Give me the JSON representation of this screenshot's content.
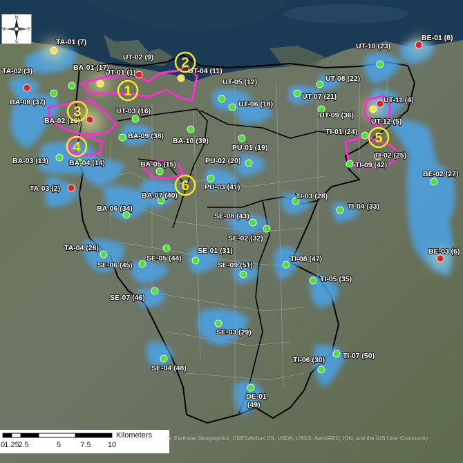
{
  "colors": {
    "green": "#4fe03a",
    "yellow": "#f4e34a",
    "red": "#e02020",
    "zone_outline": "#ff2bd6",
    "zone_label": "#ffe61a",
    "buffer": "#4aa6f0",
    "boundary": "#000000",
    "water": "#1b3a55"
  },
  "points": [
    {
      "label": "TA-01 (7)",
      "color": "yellow"
    },
    {
      "label": "UT-02 (9)",
      "color": "red"
    },
    {
      "label": "UT-01 (1)",
      "color": "yellow"
    },
    {
      "label": "UT-04 (11)",
      "color": "yellow"
    },
    {
      "label": "UT-05 (12)",
      "color": "green"
    },
    {
      "label": "UT-10 (23)",
      "color": "green"
    },
    {
      "label": "BE-01 (8)",
      "color": "red"
    },
    {
      "label": "TA-02 (3)",
      "color": "red"
    },
    {
      "label": "BA-01 (17)",
      "color": "green"
    },
    {
      "label": "BA-08 (37)",
      "color": "green"
    },
    {
      "label": "UT-08 (22)",
      "color": "green"
    },
    {
      "label": "UT-07 (21)",
      "color": "green"
    },
    {
      "label": "UT-11 (4)",
      "color": "red"
    },
    {
      "label": "UT-06 (18)",
      "color": "green"
    },
    {
      "label": "UT-03 (16)",
      "color": "green"
    },
    {
      "label": "UT-09 (36)",
      "color": "green"
    },
    {
      "label": "UT-12 (5)",
      "color": "yellow"
    },
    {
      "label": "BA-02 (10)",
      "color": "red"
    },
    {
      "label": "TI-01 (24)",
      "color": "green"
    },
    {
      "label": "BA-09 (38)",
      "color": "green"
    },
    {
      "label": "BA-10 (39)",
      "color": "green"
    },
    {
      "label": "PU-01 (19)",
      "color": "green"
    },
    {
      "label": "BA-03 (13)",
      "color": "green"
    },
    {
      "label": "BA-04 (14)",
      "color": "green"
    },
    {
      "label": "TI-02 (25)",
      "color": "green"
    },
    {
      "label": "TI-09 (42)",
      "color": "green"
    },
    {
      "label": "BA-05 (15)",
      "color": "green"
    },
    {
      "label": "PU-02 (20)",
      "color": "green"
    },
    {
      "label": "BE-02 (27)",
      "color": "green"
    },
    {
      "label": "TA-03 (2)",
      "color": "red"
    },
    {
      "label": "PU-03 (41)",
      "color": "green"
    },
    {
      "label": "BA-07 (40)",
      "color": "green"
    },
    {
      "label": "TI-03 (28)",
      "color": "green"
    },
    {
      "label": "BA-06 (34)",
      "color": "green"
    },
    {
      "label": "TI-04 (33)",
      "color": "green"
    },
    {
      "label": "SE-08 (43)",
      "color": "green"
    },
    {
      "label": "SE-02 (32)",
      "color": "green"
    },
    {
      "label": "TA-04 (26)",
      "color": "green"
    },
    {
      "label": "BE-03 (6)",
      "color": "red"
    },
    {
      "label": "SE-05 (44)",
      "color": "green"
    },
    {
      "label": "SE-01 (31)",
      "color": "green"
    },
    {
      "label": "SE-06 (45)",
      "color": "green"
    },
    {
      "label": "TI-08 (47)",
      "color": "green"
    },
    {
      "label": "SE-09 (51)",
      "color": "green"
    },
    {
      "label": "TI-05 (35)",
      "color": "green"
    },
    {
      "label": "SE-07 (46)",
      "color": "green"
    },
    {
      "label": "SE-03 (29)",
      "color": "green"
    },
    {
      "label": "TI-07 (50)",
      "color": "green"
    },
    {
      "label": "TI-06 (30)",
      "color": "green"
    },
    {
      "label": "SE-04 (48)",
      "color": "green"
    },
    {
      "label": "DE-01 (49)",
      "color": "green"
    }
  ],
  "zones": [
    "1",
    "2",
    "3",
    "4",
    "5",
    "6"
  ],
  "compass": {
    "n": "N",
    "s": "S",
    "e": "E",
    "w": "W"
  },
  "scale_bar": {
    "ticks": [
      "0",
      "1.25",
      "2.5",
      "5",
      "7.5",
      "10"
    ],
    "unit": "Kilometers"
  },
  "attribution": "rbus, Earthstar Geographics, CNES/Airbus DS, USDA, USGS, AeroGRID, IGN, and the GIS User Community"
}
